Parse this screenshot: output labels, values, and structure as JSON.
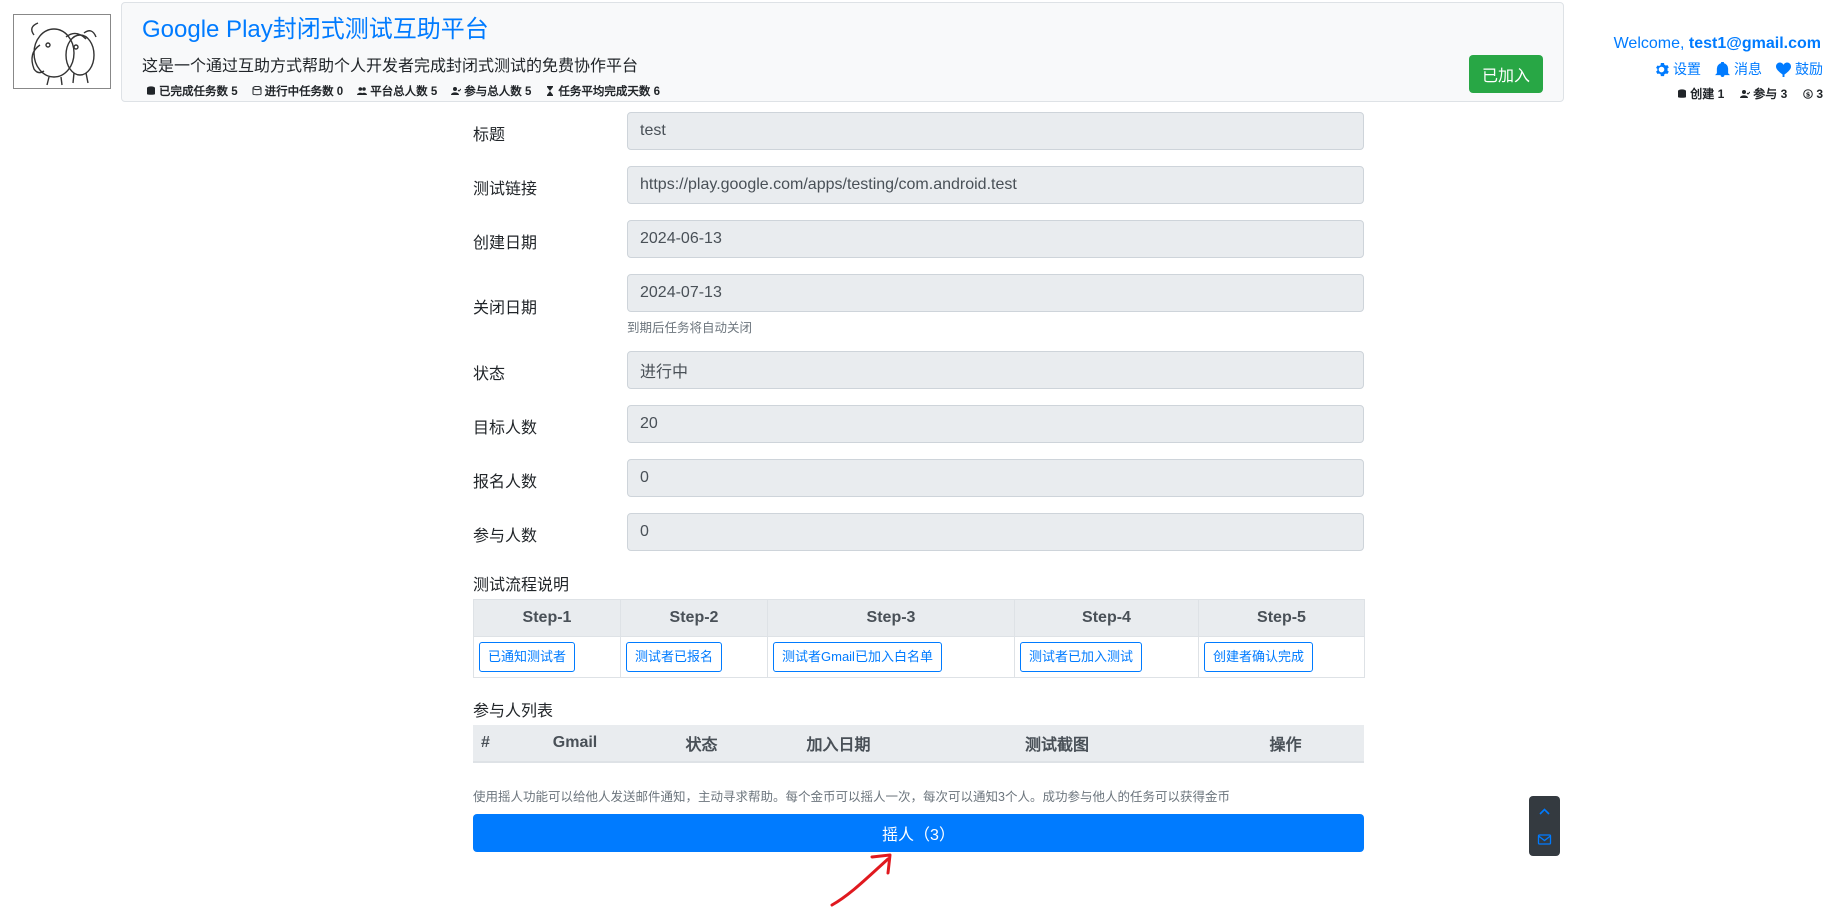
{
  "header": {
    "logo_icon": "elephant-logo-icon",
    "title": "Google Play封闭式测试互助平台",
    "subtitle": "这是一个通过互助方式帮助个人开发者完成封闭式测试的免费协作平台",
    "stats": [
      {
        "icon": "database-icon",
        "label": "已完成任务数 5"
      },
      {
        "icon": "database-icon",
        "label": "进行中任务数 0"
      },
      {
        "icon": "users-icon",
        "label": "平台总人数 5"
      },
      {
        "icon": "user-check-icon",
        "label": "参与总人数 5"
      },
      {
        "icon": "hourglass-icon",
        "label": "任务平均完成天数 6"
      }
    ],
    "joined_label": "已加入",
    "accent_color": "#007bff",
    "joined_color": "#28a745"
  },
  "user": {
    "welcome_prefix": "Welcome,",
    "email": "test1@gmail.com",
    "nav": [
      {
        "icon": "gear-icon",
        "label": "设置"
      },
      {
        "icon": "bell-icon",
        "label": "消息"
      },
      {
        "icon": "heart-icon",
        "label": "鼓励"
      }
    ],
    "counters": [
      {
        "icon": "database-icon",
        "label": "创建 1"
      },
      {
        "icon": "user-check-icon",
        "label": "参与 3"
      },
      {
        "icon": "coin-icon",
        "label": "3"
      }
    ]
  },
  "form": {
    "title": {
      "label": "标题",
      "value": "test"
    },
    "link": {
      "label": "测试链接",
      "value": "https://play.google.com/apps/testing/com.android.test"
    },
    "created": {
      "label": "创建日期",
      "value": "2024-06-13"
    },
    "closed": {
      "label": "关闭日期",
      "value": "2024-07-13",
      "hint": "到期后任务将自动关闭"
    },
    "status": {
      "label": "状态",
      "value": "进行中"
    },
    "target": {
      "label": "目标人数",
      "value": "20"
    },
    "signed": {
      "label": "报名人数",
      "value": "0"
    },
    "joined": {
      "label": "参与人数",
      "value": "0"
    }
  },
  "process": {
    "title": "测试流程说明",
    "steps": [
      {
        "header": "Step-1",
        "button": "已通知测试者"
      },
      {
        "header": "Step-2",
        "button": "测试者已报名"
      },
      {
        "header": "Step-3",
        "button": "测试者Gmail已加入白名单"
      },
      {
        "header": "Step-4",
        "button": "测试者已加入测试"
      },
      {
        "header": "Step-5",
        "button": "创建者确认完成"
      }
    ]
  },
  "participants": {
    "title": "参与人列表",
    "columns": [
      "#",
      "Gmail",
      "状态",
      "加入日期",
      "测试截图",
      "操作"
    ]
  },
  "shake": {
    "notice": "使用摇人功能可以给他人发送邮件通知，主动寻求帮助。每个金币可以摇人一次，每次可以通知3个人。成功参与他人的任务可以获得金币",
    "button_label": "摇人（3）"
  },
  "float_widget": {
    "icons": [
      "chevron-up-icon",
      "mail-icon"
    ]
  },
  "annotation": {
    "icon": "red-arrow-icon",
    "color": "#e0191f"
  }
}
